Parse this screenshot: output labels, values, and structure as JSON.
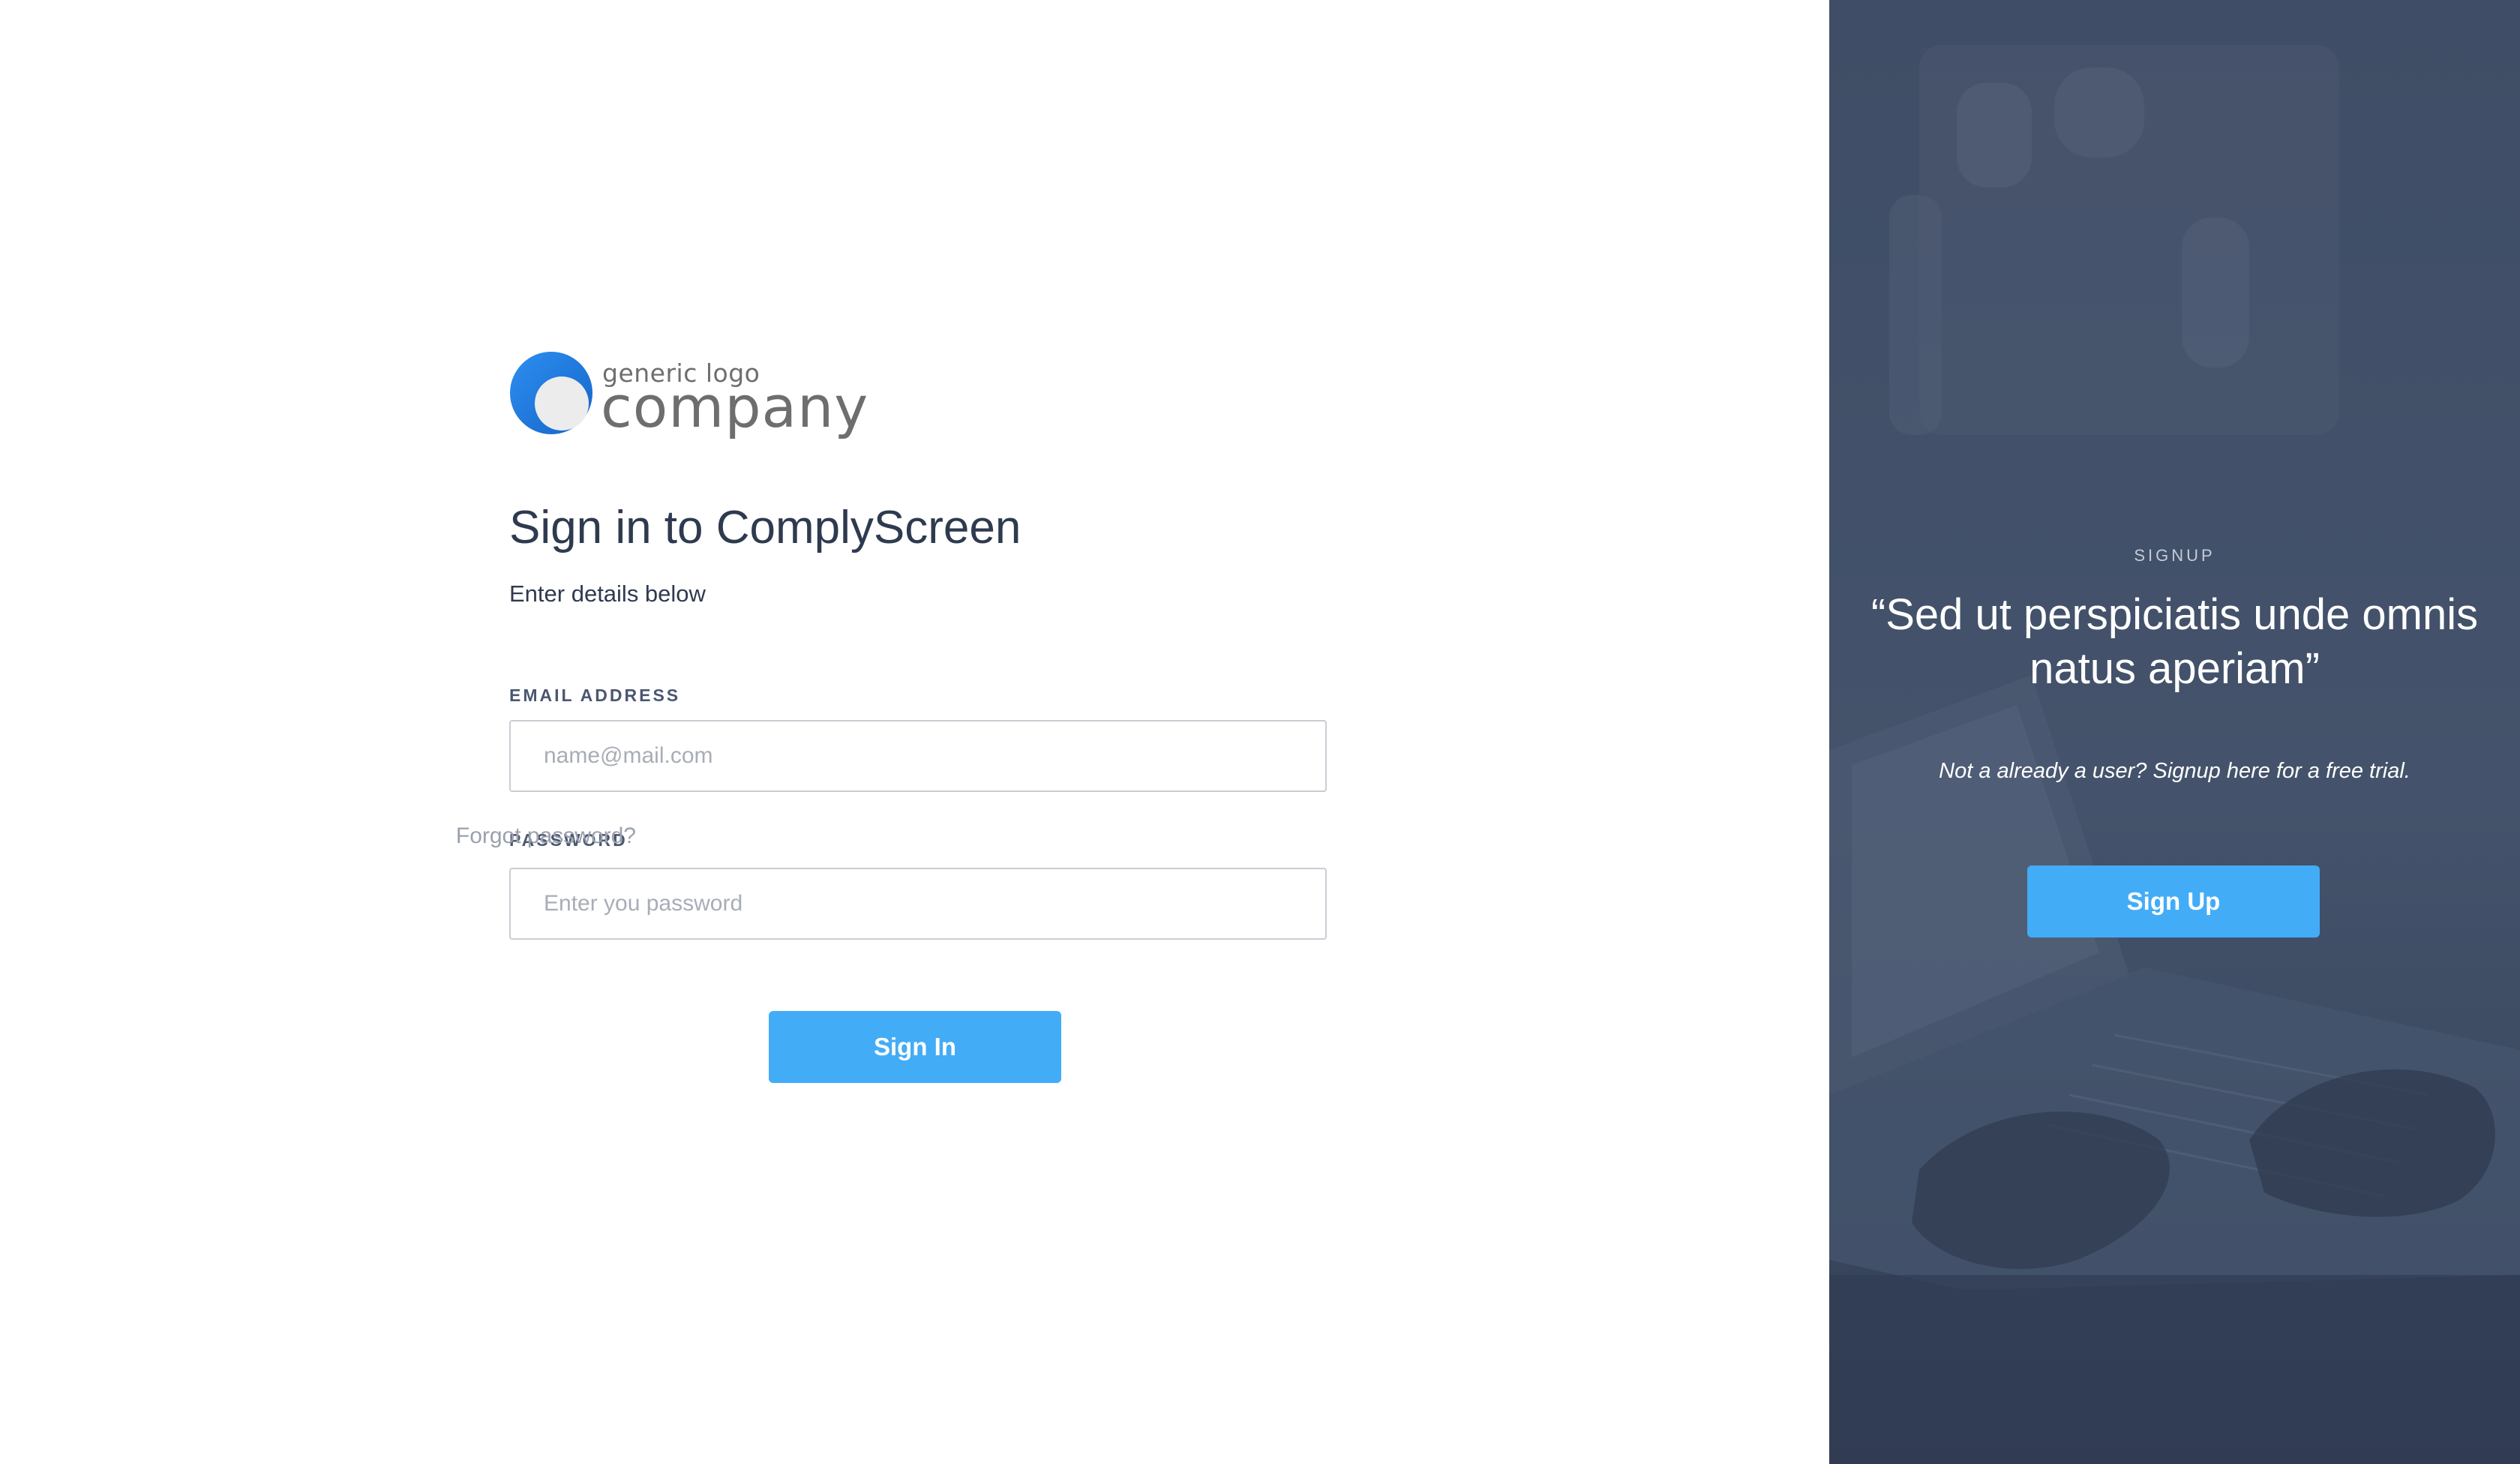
{
  "logo": {
    "tagline": "generic logo",
    "name": "company",
    "colors": {
      "primary": "#1f7de0",
      "secondary": "#eeeeee"
    }
  },
  "signin": {
    "title": "Sign in to ComplyScreen",
    "subtitle": "Enter details below",
    "email_label": "EMAIL ADDRESS",
    "email_placeholder": "name@mail.com",
    "password_label": "PASSWORD",
    "password_placeholder": "Enter you password",
    "forgot_link": "Forgot password?",
    "button_label": "Sign In"
  },
  "signup": {
    "eyebrow": "SIGNUP",
    "quote": "“Sed ut perspiciatis unde omnis natus aperiam”",
    "note": "Not a already a user? Signup here for a free trial.",
    "button_label": "Sign Up"
  },
  "colors": {
    "accent": "#43acf6",
    "heading": "#2e3a4f",
    "panel_overlay": "#3b4a62"
  }
}
